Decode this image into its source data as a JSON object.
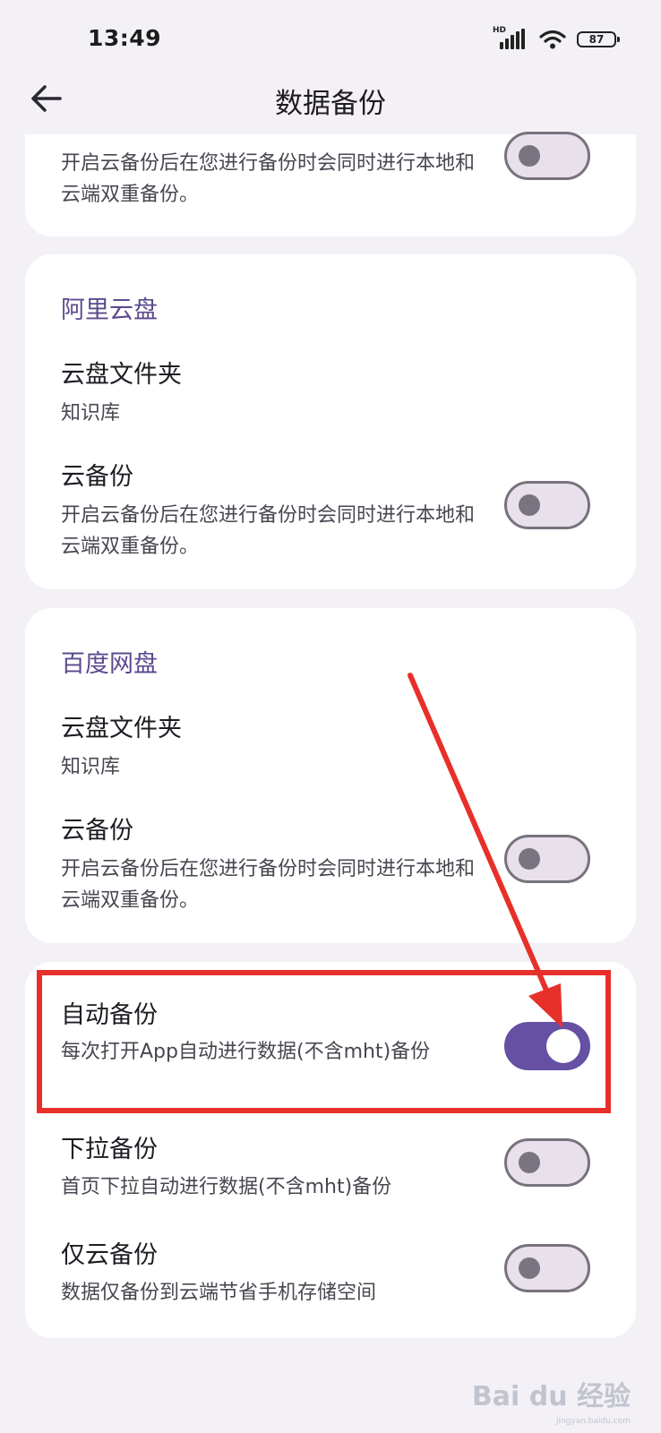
{
  "status": {
    "time": "13:49",
    "network_label": "HD",
    "battery": "87"
  },
  "app_bar": {
    "title": "数据备份"
  },
  "cards": {
    "top": {
      "subtitle": "开启云备份后在您进行备份时会同时进行本地和云端双重备份。",
      "toggle_on": false
    },
    "aliyun": {
      "header": "阿里云盘",
      "folder_title": "云盘文件夹",
      "folder_value": "知识库",
      "backup_title": "云备份",
      "backup_subtitle": "开启云备份后在您进行备份时会同时进行本地和云端双重备份。",
      "toggle_on": false
    },
    "baidu": {
      "header": "百度网盘",
      "folder_title": "云盘文件夹",
      "folder_value": "知识库",
      "backup_title": "云备份",
      "backup_subtitle": "开启云备份后在您进行备份时会同时进行本地和云端双重备份。",
      "toggle_on": false
    },
    "options": {
      "auto": {
        "title": "自动备份",
        "subtitle": "每次打开App自动进行数据(不含mht)备份",
        "toggle_on": true
      },
      "pull": {
        "title": "下拉备份",
        "subtitle": "首页下拉自动进行数据(不含mht)备份",
        "toggle_on": false
      },
      "cloud_only": {
        "title": "仅云备份",
        "subtitle": "数据仅备份到云端节省手机存储空间",
        "toggle_on": false
      }
    }
  },
  "watermark": {
    "text": "Bai du 经验",
    "url": "jingyan.baidu.com"
  },
  "colors": {
    "accent": "#6650a4",
    "annotation": "#e8302b",
    "background": "#f3f1f6"
  },
  "icons": {
    "back": "arrow-back-icon",
    "signal": "signal-icon",
    "wifi": "wifi-icon",
    "battery": "battery-icon"
  }
}
